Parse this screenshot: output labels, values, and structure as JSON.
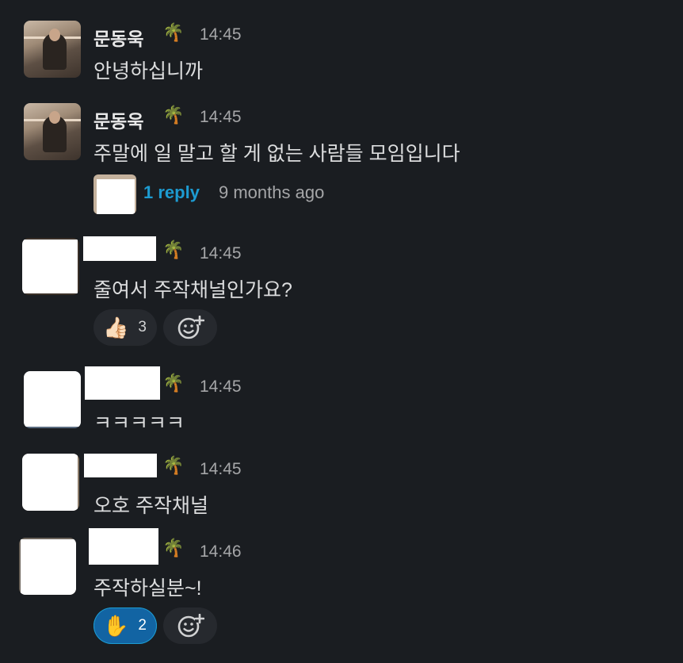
{
  "messages": [
    {
      "author": "문동욱",
      "status_emoji": "🌴",
      "time": "14:45",
      "text": "안녕하십니까"
    },
    {
      "author": "문동욱",
      "status_emoji": "🌴",
      "time": "14:45",
      "text": "주말에 일 말고 할 게 없는 사람들 모임입니다",
      "thread": {
        "reply_label": "1 reply",
        "reply_time": "9 months ago"
      }
    },
    {
      "author": "",
      "status_emoji": "🌴",
      "time": "14:45",
      "text": "줄여서 주작채널인가요?",
      "reactions": [
        {
          "emoji": "👍🏻",
          "count": "3",
          "active": false
        }
      ]
    },
    {
      "author": "",
      "status_emoji": "🌴",
      "time": "14:45",
      "text": "ㅋㅋㅋㅋㅋ"
    },
    {
      "author": "",
      "status_emoji": "🌴",
      "time": "14:45",
      "text": "오호 주작채널"
    },
    {
      "author": "",
      "status_emoji": "🌴",
      "time": "14:46",
      "text": "주작하실분~!",
      "reactions": [
        {
          "emoji": "✋",
          "count": "2",
          "active": true
        }
      ]
    }
  ],
  "colors": {
    "background": "#1a1d21",
    "link": "#1d9bd1",
    "active_reaction": "#1264a3"
  },
  "icons": {
    "add_reaction": "add-reaction-icon"
  }
}
